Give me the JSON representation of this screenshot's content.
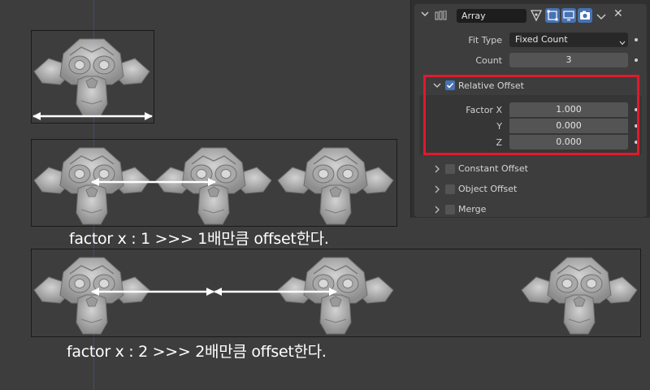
{
  "modifier": {
    "name": "Array",
    "fit_type_label": "Fit Type",
    "fit_type_value": "Fixed Count",
    "count_label": "Count",
    "count_value": "3",
    "relative_offset": {
      "label": "Relative Offset",
      "checked": true,
      "factor_x_label": "Factor X",
      "factor_x_value": "1.000",
      "y_label": "Y",
      "y_value": "0.000",
      "z_label": "Z",
      "z_value": "0.000"
    },
    "constant_offset_label": "Constant Offset",
    "object_offset_label": "Object Offset",
    "merge_label": "Merge"
  },
  "captions": {
    "row1": "factor x : 1  >>> 1배만큼 offset한다.",
    "row2": "factor x : 2  >>> 2배만큼 offset한다."
  },
  "colors": {
    "highlight": "#e0192d",
    "accent": "#4772b3",
    "viewport": "#3d3d3d"
  }
}
